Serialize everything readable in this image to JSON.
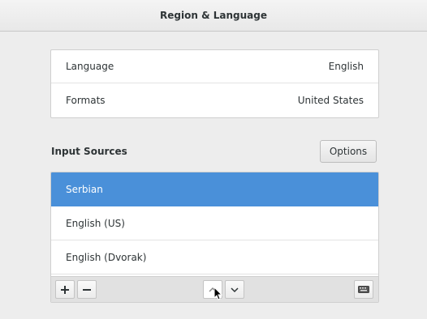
{
  "window": {
    "title": "Region & Language"
  },
  "language_section": {
    "rows": [
      {
        "label": "Language",
        "value": "English"
      },
      {
        "label": "Formats",
        "value": "United States"
      }
    ]
  },
  "input_sources": {
    "label": "Input Sources",
    "options_button_label": "Options",
    "items": [
      {
        "label": "Serbian",
        "selected": true
      },
      {
        "label": "English (US)",
        "selected": false
      },
      {
        "label": "English (Dvorak)",
        "selected": false
      }
    ],
    "toolbar": {
      "add_icon": "plus-icon",
      "remove_icon": "minus-icon",
      "move_up_icon": "chevron-up-icon",
      "move_down_icon": "chevron-down-icon",
      "keyboard_icon": "keyboard-icon"
    }
  },
  "colors": {
    "selection": "#4a90d9",
    "background": "#ededed"
  }
}
